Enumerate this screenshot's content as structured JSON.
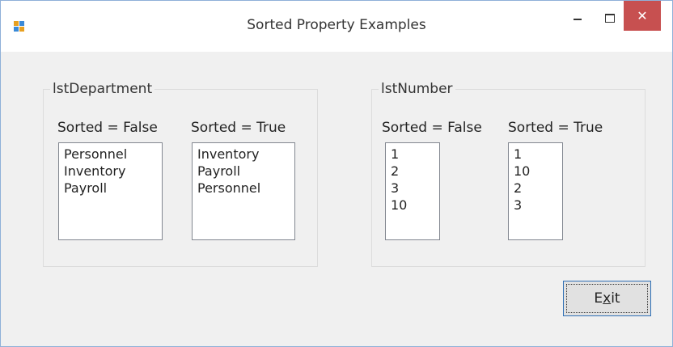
{
  "window": {
    "title": "Sorted Property Examples",
    "icon": "app-icon",
    "controls": {
      "minimize": "minimize-icon",
      "maximize": "maximize-icon",
      "close": "close-icon"
    }
  },
  "groups": {
    "department": {
      "title": "lstDepartment",
      "unsorted_label": "Sorted = False",
      "sorted_label": "Sorted = True",
      "unsorted_items": [
        "Personnel",
        "Inventory",
        "Payroll"
      ],
      "sorted_items": [
        "Inventory",
        "Payroll",
        "Personnel"
      ]
    },
    "number": {
      "title": "lstNumber",
      "unsorted_label": "Sorted = False",
      "sorted_label": "Sorted = True",
      "unsorted_items": [
        "1",
        "2",
        "3",
        "10"
      ],
      "sorted_items": [
        "1",
        "10",
        "2",
        "3"
      ]
    }
  },
  "exit_button": {
    "before": "E",
    "accel": "x",
    "after": "it"
  },
  "colors": {
    "close_button": "#c75050",
    "focus_border": "#2f6fb5"
  }
}
